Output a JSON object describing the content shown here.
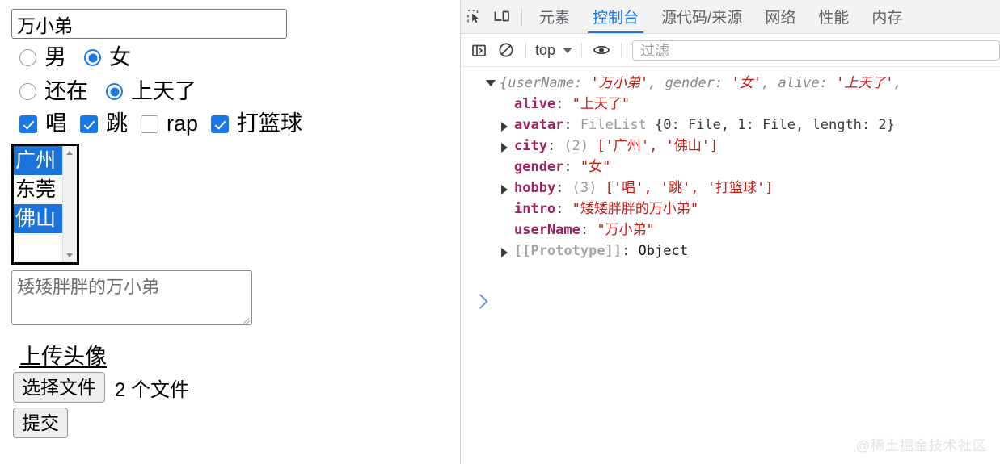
{
  "form": {
    "username": {
      "value": "万小弟"
    },
    "gender": {
      "options": [
        {
          "label": "男",
          "checked": false
        },
        {
          "label": "女",
          "checked": true
        }
      ]
    },
    "alive": {
      "options": [
        {
          "label": "还在",
          "checked": false
        },
        {
          "label": "上天了",
          "checked": true
        }
      ]
    },
    "hobby": {
      "options": [
        {
          "label": "唱",
          "checked": true
        },
        {
          "label": "跳",
          "checked": true
        },
        {
          "label": "rap",
          "checked": false
        },
        {
          "label": "打篮球",
          "checked": true
        }
      ]
    },
    "city": {
      "options": [
        {
          "label": "广州",
          "selected": true
        },
        {
          "label": "东莞",
          "selected": false
        },
        {
          "label": "佛山",
          "selected": true
        }
      ]
    },
    "intro": {
      "value": "矮矮胖胖的万小弟"
    },
    "upload": {
      "title": "上传头像",
      "choose_label": "选择文件",
      "file_count": "2 个文件"
    },
    "submit_label": "提交"
  },
  "devtools": {
    "icons": {
      "inspect": "inspect-element-icon",
      "device": "device-toolbar-icon",
      "sidebar": "console-sidebar-icon",
      "clear": "clear-console-icon",
      "eye": "live-expression-icon"
    },
    "tabs": [
      {
        "label": "元素",
        "active": false
      },
      {
        "label": "控制台",
        "active": true
      },
      {
        "label": "源代码/来源",
        "active": false
      },
      {
        "label": "网络",
        "active": false
      },
      {
        "label": "性能",
        "active": false
      },
      {
        "label": "内存",
        "active": false
      }
    ],
    "toolbar": {
      "context_label": "top",
      "filter_placeholder": "过滤"
    },
    "console": {
      "preview": {
        "open_brace": "{",
        "parts": "userName: '万小弟', gender: '女', alive: '上天了', ",
        "key1": "userName: ",
        "val1": "'万小弟'",
        "key2": ", gender: ",
        "val2": "'女'",
        "key3": ", alive: ",
        "val3": "'上天了'",
        "tail": ", "
      },
      "props": [
        {
          "expandable": false,
          "key": "alive",
          "sep": ": ",
          "value": "\"上天了\"",
          "kind": "string"
        },
        {
          "expandable": true,
          "key": "avatar",
          "sep": ": ",
          "classname": "FileList ",
          "value": "{0: File, 1: File, length: 2}",
          "kind": "filelist"
        },
        {
          "expandable": true,
          "key": "city",
          "sep": ": ",
          "count": "(2) ",
          "value": "['广州', '佛山']",
          "kind": "array"
        },
        {
          "expandable": false,
          "key": "gender",
          "sep": ": ",
          "value": "\"女\"",
          "kind": "string"
        },
        {
          "expandable": true,
          "key": "hobby",
          "sep": ": ",
          "count": "(3) ",
          "value": "['唱', '跳', '打篮球']",
          "kind": "array"
        },
        {
          "expandable": false,
          "key": "intro",
          "sep": ": ",
          "value": "\"矮矮胖胖的万小弟\"",
          "kind": "string"
        },
        {
          "expandable": false,
          "key": "userName",
          "sep": ": ",
          "value": "\"万小弟\"",
          "kind": "string"
        },
        {
          "expandable": true,
          "key": "[[Prototype]]",
          "sep": ": ",
          "value": "Object",
          "kind": "proto"
        }
      ]
    }
  },
  "watermark": "@稀土掘金技术社区",
  "colors": {
    "accent_blue": "#1b77e8",
    "devtools_active": "#1a73e8",
    "string_red": "#c41a16",
    "key_maroon": "#9c2161",
    "select_blue": "#1b72d8"
  }
}
